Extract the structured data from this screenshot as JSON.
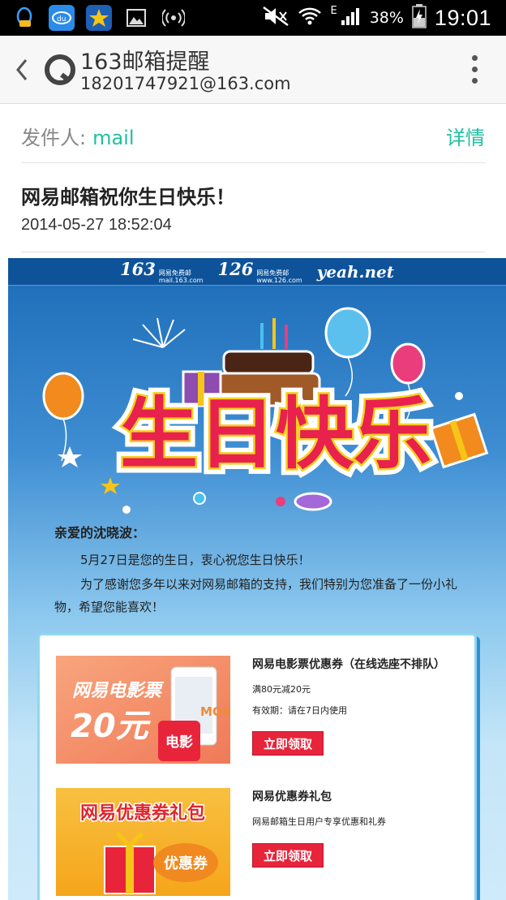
{
  "status_bar": {
    "battery_percent": "38%",
    "network_type": "E",
    "time": "19:01",
    "icons": [
      "qq-icon",
      "baidu-icon",
      "star-app-icon",
      "gallery-icon",
      "wireless-icon",
      "mute-icon",
      "wifi-icon",
      "signal-icon",
      "battery-charging-icon"
    ]
  },
  "app_bar": {
    "title": "163邮箱提醒",
    "subtitle": "18201747921@163.com"
  },
  "mail": {
    "sender_label": "发件人:",
    "sender_name": "mail",
    "details_link": "详情",
    "subject": "网易邮箱祝你生日快乐！",
    "datetime": "2014-05-27 18:52:04"
  },
  "body": {
    "brand_163": "163",
    "brand_163_sub1": "网易免费邮",
    "brand_163_sub2": "mail.163.com",
    "brand_126": "126",
    "brand_126_sub1": "网易免费邮",
    "brand_126_sub2": "www.126.com",
    "brand_yeah": "yeah.net",
    "hero_text": "生日快乐",
    "greeting": "亲爱的沈晓波：",
    "paragraph1": "5月27日是您的生日，衷心祝您生日快乐！",
    "paragraph2": "为了感谢您多年以来对网易邮箱的支持，我们特别为您准备了一份小礼物，希望您能喜欢！"
  },
  "offers": [
    {
      "title": "网易电影票优惠券（在线选座不排队）",
      "line1": "满80元减20元",
      "line2": "有效期：请在7日内使用",
      "button": "立即领取",
      "image_text1": "网易电影票",
      "image_text2": "20元",
      "image_badge": "电影",
      "image_corner": "MOV"
    },
    {
      "title": "网易优惠券礼包",
      "line1": "网易邮箱生日用户专享优惠和礼券",
      "button": "立即领取",
      "image_text1": "网易优惠券礼包",
      "image_badge": "优惠券"
    }
  ],
  "colors": {
    "accent_teal": "#1fc0a0",
    "button_red": "#e8243b",
    "brand_blue": "#0e5399"
  }
}
